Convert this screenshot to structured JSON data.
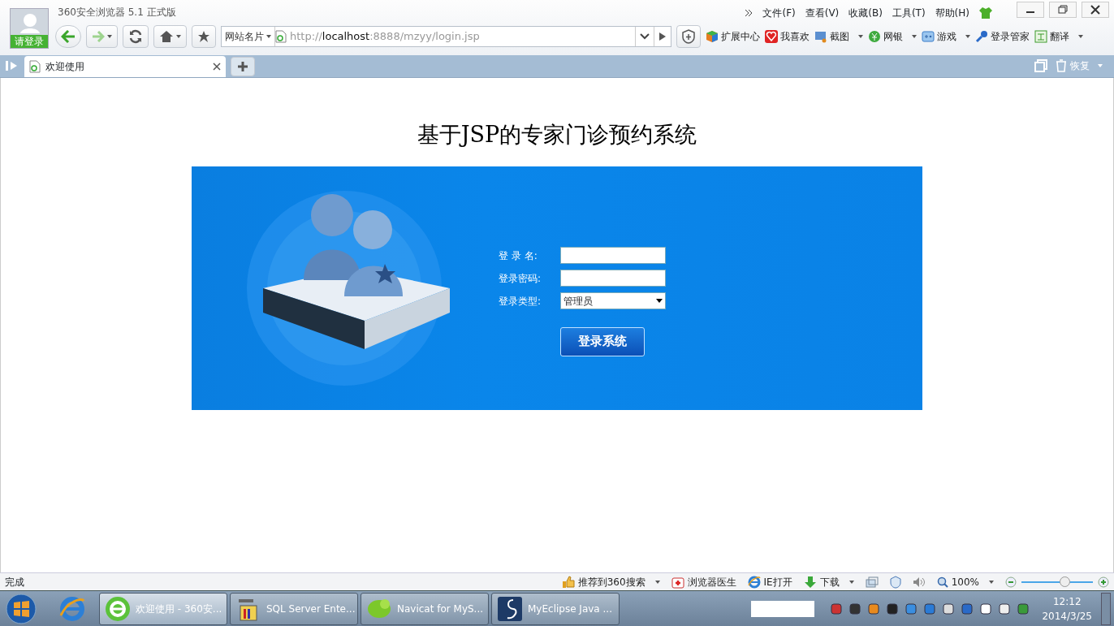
{
  "browser": {
    "title": "360安全浏览器 5.1 正式版",
    "login_label": "请登录",
    "menu": [
      "文件(F)",
      "查看(V)",
      "收藏(B)",
      "工具(T)",
      "帮助(H)"
    ],
    "site_card": "网站名片",
    "url": {
      "scheme": "http://",
      "host": "localhost",
      "rest": ":8888/mzyy/login.jsp"
    },
    "toolbar_items": [
      {
        "label": "扩展中心",
        "kind": "cube",
        "dropdown": false
      },
      {
        "label": "我喜欢",
        "kind": "heart",
        "dropdown": false
      },
      {
        "label": "截图",
        "kind": "screen",
        "dropdown": true
      },
      {
        "label": "网银",
        "kind": "coin",
        "dropdown": true
      },
      {
        "label": "游戏",
        "kind": "game",
        "dropdown": true
      },
      {
        "label": "登录管家",
        "kind": "key",
        "dropdown": false
      },
      {
        "label": "翻译",
        "kind": "translate",
        "dropdown": true
      }
    ],
    "tabs": [
      {
        "label": "欢迎使用",
        "selected": true
      }
    ],
    "restore_label": "恢复"
  },
  "page": {
    "heading": "基于JSP的专家门诊预约系统",
    "fields": [
      {
        "label": "登 录 名:",
        "kind": "text"
      },
      {
        "label": "登录密码:",
        "kind": "password"
      },
      {
        "label": "登录类型:",
        "kind": "select",
        "value": "管理员"
      }
    ],
    "submit": "登录系统"
  },
  "status_bar": {
    "text": "完成",
    "items": [
      {
        "label": "推荐到360搜索",
        "kind": "thumb",
        "dropdown": true
      },
      {
        "label": "浏览器医生",
        "kind": "medkit",
        "dropdown": false
      },
      {
        "label": "IE打开",
        "kind": "ie",
        "dropdown": false
      },
      {
        "label": "下载",
        "kind": "download",
        "dropdown": true
      }
    ],
    "zoom": "100%",
    "zoom_slider": {
      "level": 0.6
    }
  },
  "taskbar": {
    "tasks": [
      {
        "label": "欢迎使用 - 360安...",
        "kind": "browser360",
        "selected": true
      },
      {
        "label": "SQL Server Ente...",
        "kind": "sql",
        "selected": false
      },
      {
        "label": "Navicat for MyS...",
        "kind": "navicat",
        "selected": false
      },
      {
        "label": "MyEclipse Java ...",
        "kind": "eclipse",
        "selected": false
      }
    ],
    "time": "12:12",
    "date": "2014/3/25"
  }
}
